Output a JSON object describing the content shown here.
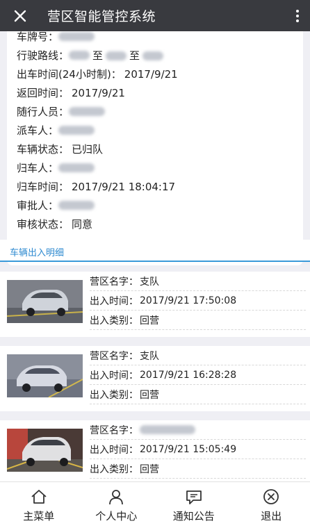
{
  "header": {
    "title": "营区智能管控系统",
    "close_icon": "close-icon",
    "more_icon": "more-vertical-icon"
  },
  "detail": {
    "cut_row": {
      "label": "车牌号："
    },
    "rows": [
      {
        "label": "行驶路线：",
        "value": "至",
        "value2": "至"
      },
      {
        "label": "出车时间(24小时制)：",
        "value": "2017/9/21"
      },
      {
        "label": "返回时间：",
        "value": "2017/9/21"
      },
      {
        "label": "随行人员：",
        "value": ""
      },
      {
        "label": "派车人：",
        "value": ""
      },
      {
        "label": "车辆状态：",
        "value": "已归队"
      },
      {
        "label": "归车人：",
        "value": ""
      },
      {
        "label": "归车时间：",
        "value": "2017/9/21 18:04:17"
      },
      {
        "label": "审批人：",
        "value": ""
      },
      {
        "label": "审核状态：",
        "value": "同意"
      }
    ]
  },
  "records_section": {
    "title": "车辆出入明细"
  },
  "records": [
    {
      "camp_label": "营区名字：",
      "camp": "支队",
      "time_label": "出入时间：",
      "time": "2017/9/21 17:50:08",
      "type_label": "出入类别：",
      "type": "回营"
    },
    {
      "camp_label": "营区名字：",
      "camp": "支队",
      "time_label": "出入时间：",
      "time": "2017/9/21 16:28:28",
      "type_label": "出入类别：",
      "type": "回营"
    },
    {
      "camp_label": "营区名字：",
      "camp": "",
      "time_label": "出入时间：",
      "time": "2017/9/21 15:05:49",
      "type_label": "出入类别：",
      "type": "回营"
    }
  ],
  "nav": [
    {
      "label": "主菜单",
      "icon": "home-icon"
    },
    {
      "label": "个人中心",
      "icon": "user-icon"
    },
    {
      "label": "通知公告",
      "icon": "message-icon"
    },
    {
      "label": "退出",
      "icon": "exit-icon"
    }
  ],
  "colors": {
    "topbar": "#393a3f",
    "accent": "#2e8ad0",
    "background": "#efeff4"
  }
}
